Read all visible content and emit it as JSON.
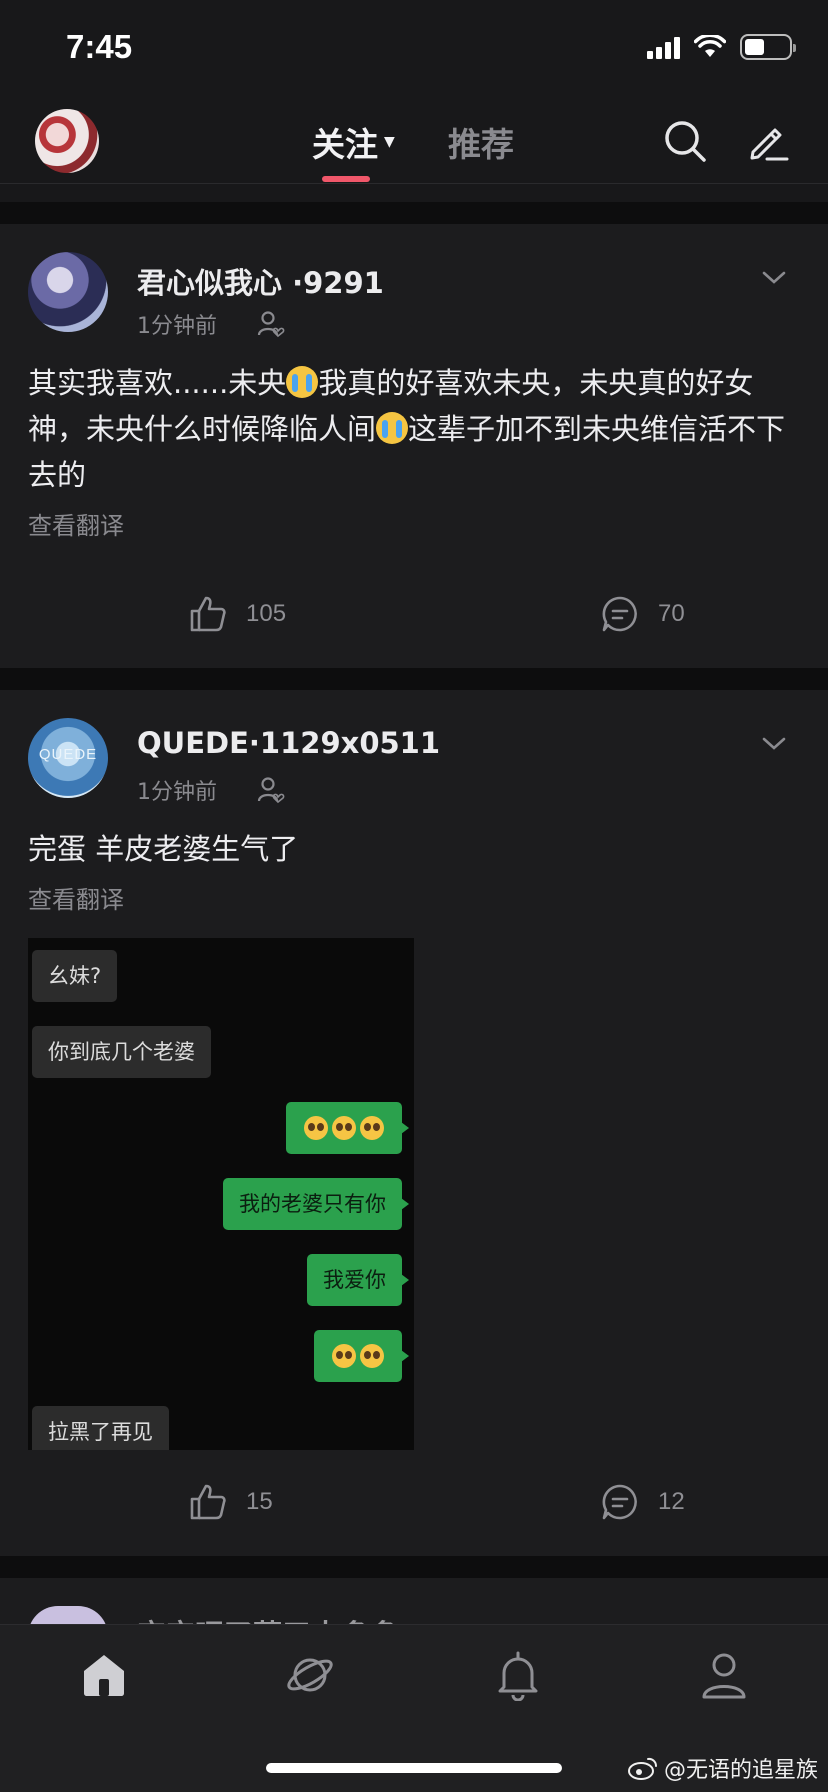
{
  "status_bar": {
    "time": "7:45"
  },
  "top_nav": {
    "tabs": [
      {
        "label": "关注",
        "active": true
      },
      {
        "label": "推荐",
        "active": false
      }
    ]
  },
  "posts": [
    {
      "username": "君心似我心 ·9291",
      "timestamp": "1分钟前",
      "text_parts": [
        "其实我喜欢......未央",
        "我真的好喜欢未央，未央真的好女神，未央什么时候降临人间",
        "这辈子加不到未央维信活不下去的"
      ],
      "translate_label": "查看翻译",
      "likes": "105",
      "comments": "70"
    },
    {
      "username": "QUEDE·1129x0511",
      "avatar_text": "QUEDE",
      "timestamp": "1分钟前",
      "text": "完蛋 羊皮老婆生气了",
      "translate_label": "查看翻译",
      "chat_messages": [
        {
          "side": "in",
          "text": "幺妹?"
        },
        {
          "side": "in",
          "text": "你到底几个老婆"
        },
        {
          "side": "out",
          "text": "",
          "emoji": "pleading-face x3"
        },
        {
          "side": "out",
          "text": "我的老婆只有你"
        },
        {
          "side": "out",
          "text": "我爱你"
        },
        {
          "side": "out",
          "text": "",
          "emoji": "pleading-face x2"
        },
        {
          "side": "in",
          "text": "拉黑了再见"
        }
      ],
      "likes": "15",
      "comments": "12"
    }
  ],
  "next_post_peek": {
    "username": "宝宝嘿了薄三大多多"
  },
  "tab_bar": {
    "tabs": [
      {
        "name": "home",
        "icon": "home-icon",
        "active": true
      },
      {
        "name": "discover",
        "icon": "planet-icon",
        "active": false
      },
      {
        "name": "notifications",
        "icon": "bell-icon",
        "active": false
      },
      {
        "name": "profile",
        "icon": "person-icon",
        "active": false
      }
    ]
  },
  "watermark": "@无语的追星族",
  "colors": {
    "accent": "#f0576a",
    "chat_green": "#2ba14d"
  }
}
